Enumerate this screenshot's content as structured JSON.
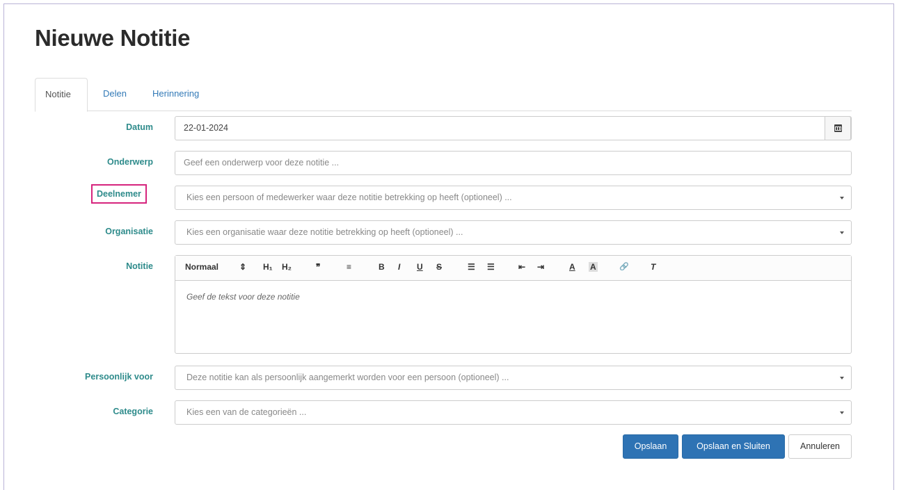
{
  "page": {
    "title": "Nieuwe Notitie"
  },
  "tabs": [
    {
      "label": "Notitie",
      "active": true
    },
    {
      "label": "Delen"
    },
    {
      "label": "Herinnering"
    }
  ],
  "form": {
    "datum": {
      "label": "Datum",
      "value": "22-01-2024"
    },
    "onderwerp": {
      "label": "Onderwerp",
      "placeholder": "Geef een onderwerp voor deze notitie ..."
    },
    "deelnemer": {
      "label": "Deelnemer",
      "placeholder": "Kies een persoon of medewerker waar deze notitie betrekking op heeft (optioneel) ..."
    },
    "organisatie": {
      "label": "Organisatie",
      "placeholder": "Kies een organisatie waar deze notitie betrekking op heeft (optioneel) ..."
    },
    "notitie": {
      "label": "Notitie",
      "toolbar": {
        "heading_select": "Normaal",
        "h1": "H₁",
        "h2": "H₂",
        "blockquote": "❞",
        "align": "≡",
        "bold": "B",
        "italic": "I",
        "underline": "U",
        "strike": "S",
        "ordered_list": "☰",
        "bullet_list": "☰",
        "outdent": "⇤",
        "indent": "⇥",
        "color": "A",
        "background": "A",
        "link": "🔗",
        "clean": "T"
      },
      "placeholder": "Geef de tekst voor deze notitie"
    },
    "persoonlijk": {
      "label": "Persoonlijk voor",
      "placeholder": "Deze notitie kan als persoonlijk aangemerkt worden voor een persoon (optioneel) ..."
    },
    "categorie": {
      "label": "Categorie",
      "placeholder": "Kies een van de categorieën ..."
    }
  },
  "buttons": {
    "save": "Opslaan",
    "save_close": "Opslaan en Sluiten",
    "cancel": "Annuleren"
  },
  "colors": {
    "primary": "#2e73b4",
    "label": "#2e8b8b",
    "highlight": "#d6247d"
  }
}
